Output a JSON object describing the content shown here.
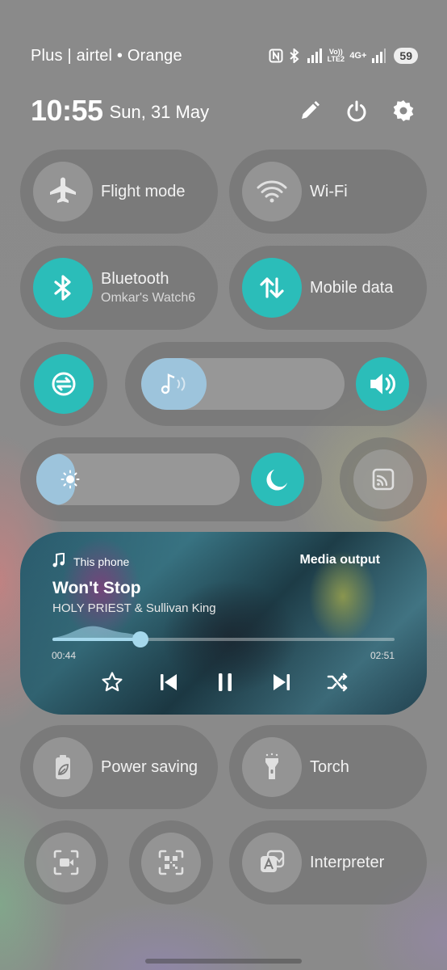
{
  "status_bar": {
    "carrier": "Plus | airtel • Orange",
    "icons": [
      "nfc-icon",
      "bluetooth-icon",
      "signal-r-icon",
      "volte-lte2-icon",
      "4g-plus-icon",
      "signal-icon"
    ],
    "volte_text": "Vo)) LTE2",
    "net_text": "4G+",
    "battery": "59"
  },
  "header": {
    "time": "10:55",
    "date": "Sun, 31 May",
    "icons": [
      "edit-icon",
      "power-icon",
      "settings-icon"
    ]
  },
  "tiles": {
    "flight": {
      "label": "Flight mode",
      "icon": "airplane-icon",
      "active": false
    },
    "wifi": {
      "label": "Wi-Fi",
      "icon": "wifi-icon",
      "active": false
    },
    "bluetooth": {
      "label": "Bluetooth",
      "sub": "Omkar's Watch6",
      "icon": "bluetooth-icon",
      "active": true
    },
    "mobile_data": {
      "label": "Mobile data",
      "icon": "data-arrows-icon",
      "active": true
    },
    "power_saving": {
      "label": "Power saving",
      "icon": "battery-leaf-icon",
      "active": false
    },
    "torch": {
      "label": "Torch",
      "icon": "torch-icon",
      "active": false
    },
    "interpreter": {
      "label": "Interpreter",
      "icon": "translate-icon",
      "active": false
    }
  },
  "volume": {
    "level": 0.32,
    "icon": "music-note-icon",
    "button_icon": "speaker-icon"
  },
  "brightness": {
    "level": 0.19,
    "icon": "sun-icon",
    "night_icon": "moon-icon"
  },
  "media": {
    "source": "This phone",
    "output": "Media output",
    "title": "Won't Stop",
    "artist": "HOLY PRIEST & Sullivan King",
    "elapsed": "00:44",
    "duration": "02:51",
    "progress": 0.257,
    "controls": [
      "star-icon",
      "previous-icon",
      "pause-icon",
      "next-icon",
      "shuffle-icon"
    ]
  },
  "colors": {
    "accent": "#2bbdb9",
    "slider_fill": "#9dc4dc"
  }
}
